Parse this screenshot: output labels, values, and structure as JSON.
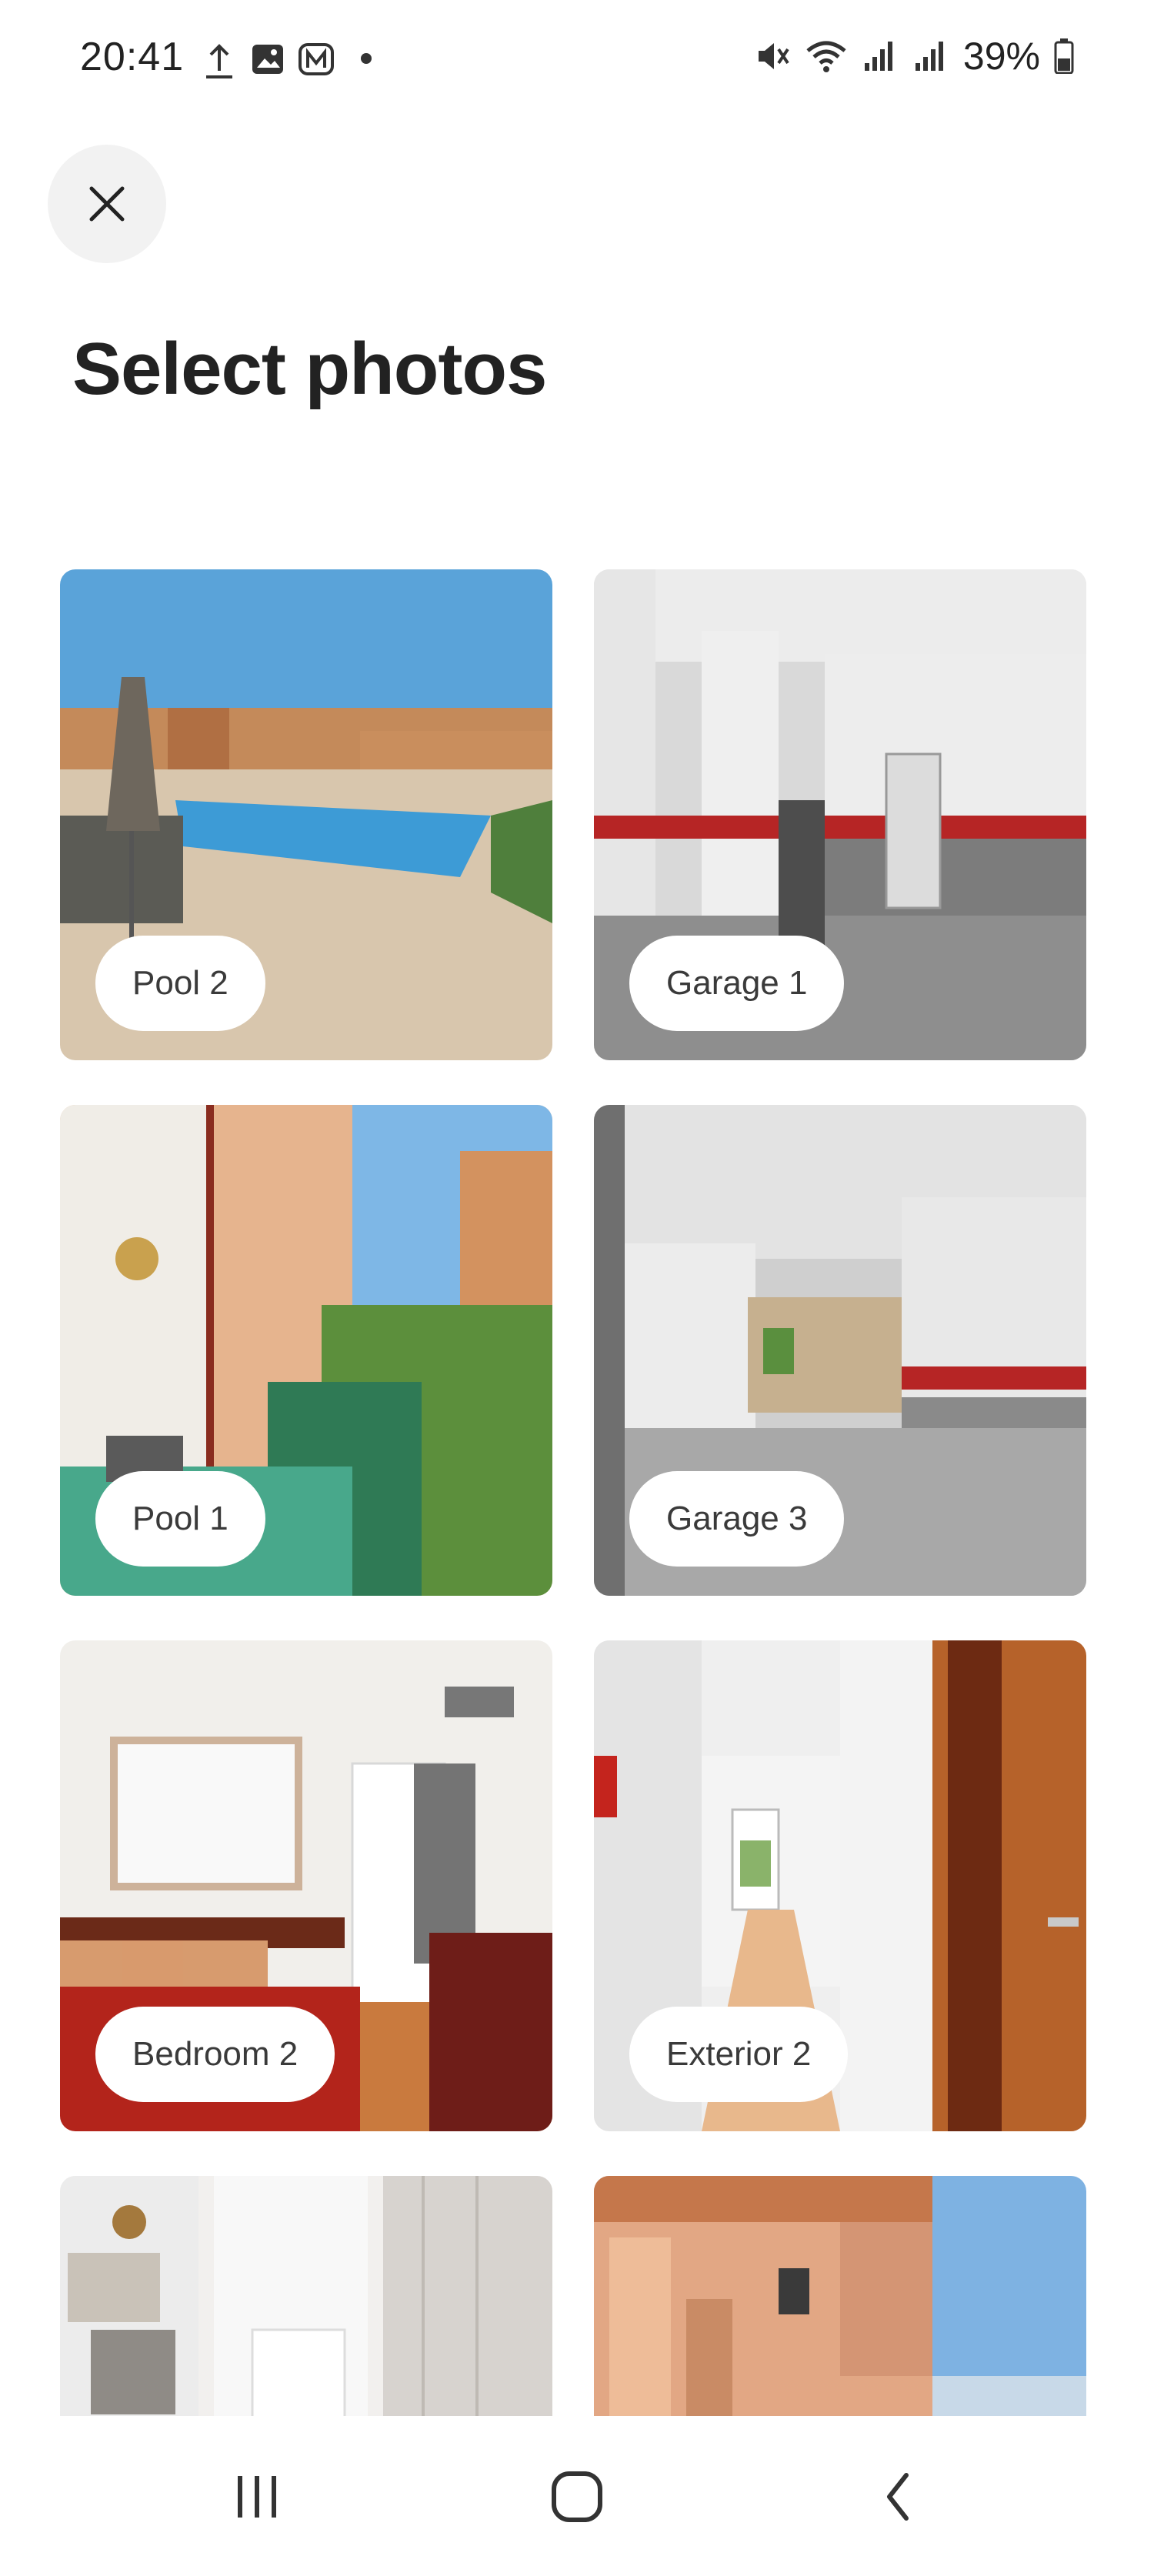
{
  "status_bar": {
    "time": "20:41",
    "battery": "39%",
    "icons_left": [
      "upload-icon",
      "gallery-icon",
      "metro-icon",
      "dot-icon"
    ],
    "icons_right": [
      "mute-icon",
      "wifi-icon",
      "signal-icon",
      "signal-icon",
      "battery-icon"
    ]
  },
  "header": {
    "close_icon": "close-icon",
    "title": "Select photos"
  },
  "photos": [
    {
      "label": "Pool 2"
    },
    {
      "label": "Garage 1"
    },
    {
      "label": "Pool 1"
    },
    {
      "label": "Garage 3"
    },
    {
      "label": "Bedroom 2"
    },
    {
      "label": "Exterior 2"
    }
  ],
  "nav_bar": {
    "recents_icon": "recents-icon",
    "home_icon": "home-icon",
    "back_icon": "back-icon"
  }
}
